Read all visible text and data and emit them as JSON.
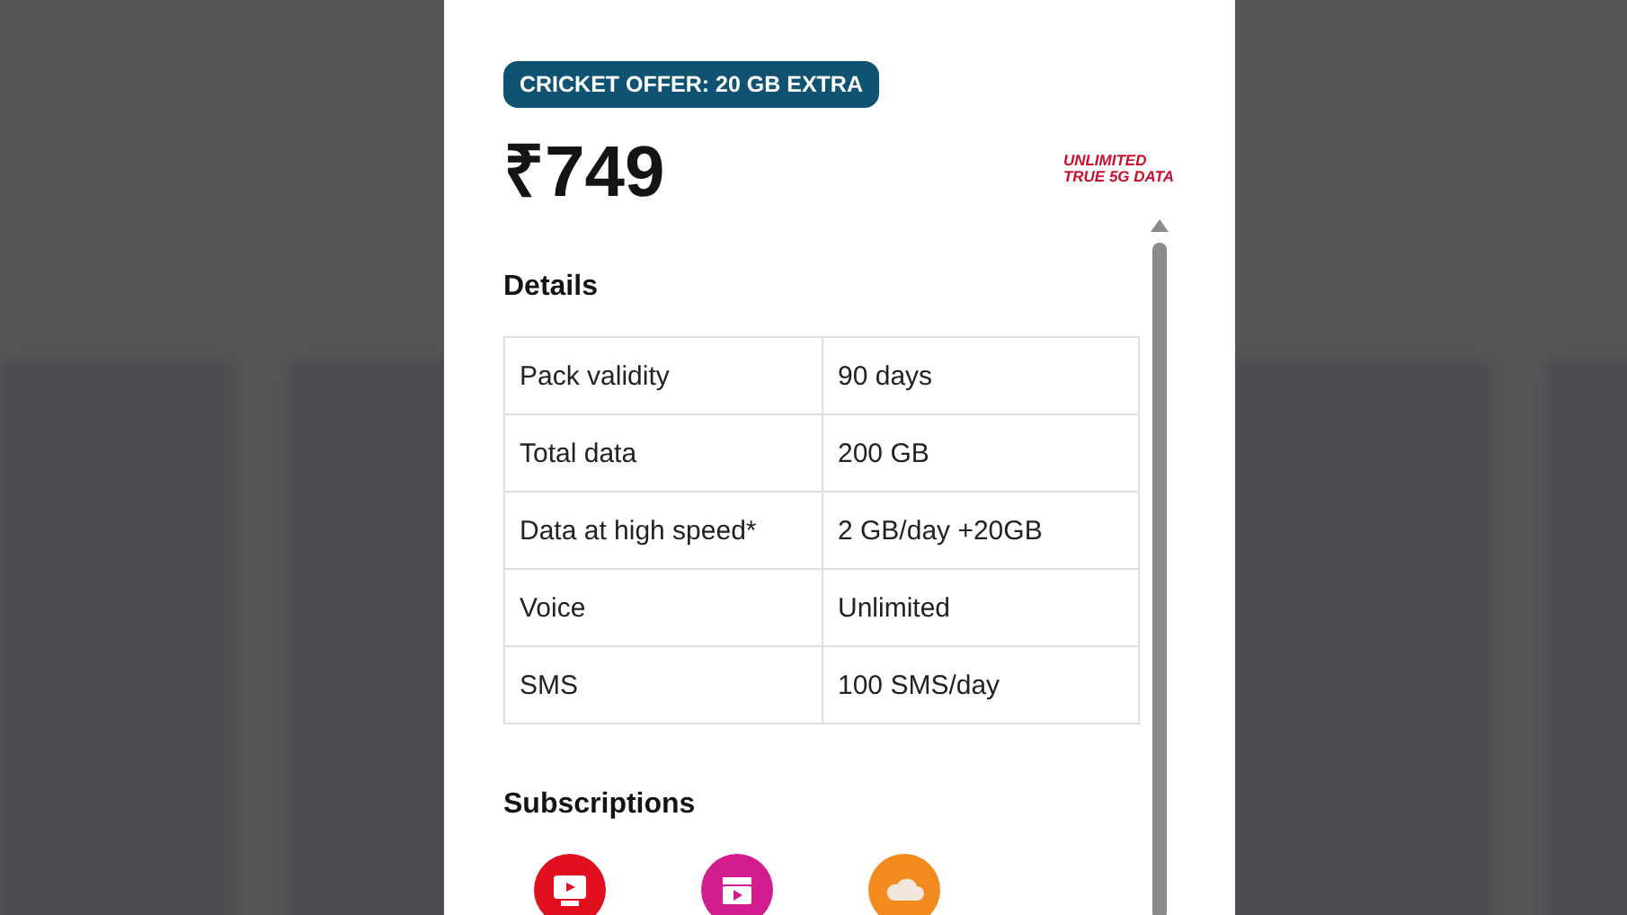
{
  "plan": {
    "offer_badge": "CRICKET OFFER: 20 GB EXTRA",
    "price": "₹749",
    "tag": [
      "UNLIMITED",
      "TRUE 5G DATA"
    ]
  },
  "details": {
    "title": "Details",
    "rows": [
      {
        "label": "Pack validity",
        "value": "90 days"
      },
      {
        "label": "Total data",
        "value": "200 GB"
      },
      {
        "label": "Data at high speed*",
        "value": "2 GB/day +20GB"
      },
      {
        "label": "Voice",
        "value": "Unlimited"
      },
      {
        "label": "SMS",
        "value": "100 SMS/day"
      }
    ]
  },
  "subscriptions": {
    "title": "Subscriptions",
    "items": [
      {
        "kind": "tv",
        "color": "#e0101e"
      },
      {
        "kind": "clapper",
        "color": "#d21d8f"
      },
      {
        "kind": "cloud",
        "color": "#f28a1e"
      }
    ]
  }
}
